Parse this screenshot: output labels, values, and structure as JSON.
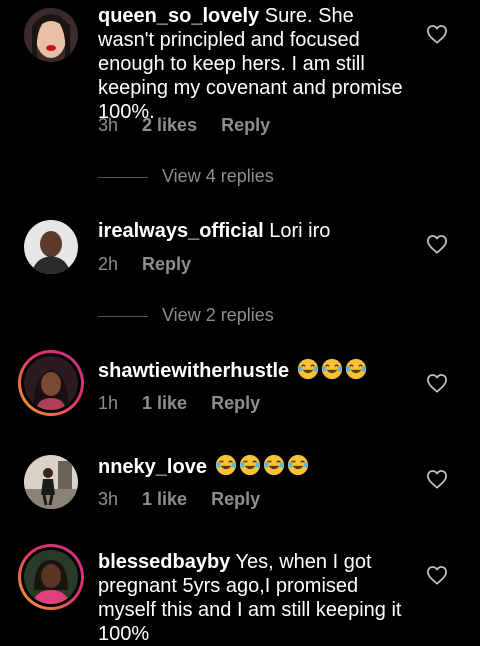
{
  "comments": [
    {
      "username": "queen_so_lovely",
      "text": "Sure. She wasn't principled and focused enough to keep hers. I am still keeping my covenant and promise 100%.",
      "time": "3h",
      "likes": "2 likes",
      "reply": "Reply"
    },
    {
      "username": "irealways_official",
      "text": "Lori iro",
      "time": "2h",
      "reply": "Reply"
    },
    {
      "username": "shawtiewitherhustle",
      "text": "",
      "emoji_count": 3,
      "time": "1h",
      "likes": "1 like",
      "reply": "Reply"
    },
    {
      "username": "nneky_love",
      "text": "",
      "emoji_count": 4,
      "time": "3h",
      "likes": "1 like",
      "reply": "Reply"
    },
    {
      "username": "blessedbayby",
      "text": "Yes, when I got pregnant 5yrs ago,I promised myself this and I am still keeping it 100%"
    }
  ],
  "view_replies": [
    "View 4 replies",
    "View 2 replies"
  ],
  "icons": {
    "heart": "heart-outline-icon",
    "emoji": "face-with-tears-of-joy-icon"
  },
  "colors": {
    "background": "#000000",
    "text": "#ffffff",
    "muted": "#8e8e8e",
    "emoji_yellow": "#f7c23a"
  }
}
